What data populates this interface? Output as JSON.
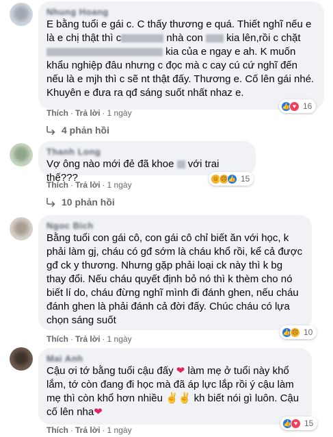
{
  "comments": [
    {
      "name": "Nhung Hoang",
      "text": "E bằng tuổi e gái c. C thấy thương e quá. Thiết nghĩ nếu e là e chị thật thì c",
      "text_b": " nhà con ",
      "text_c": " kia lên,rồi c chặt",
      "text_d": " kia của e ngay e ah. K muốn khẩu nghiệp đâu nhưng c đọc mà c cay cú cứ nghĩ đến nếu là e mjh thì c sẽ nt thật đấy. Thương e. Cố lên gái nhé. Khuyên e đưa ra qđ sáng suốt nhất nhaz e.",
      "like": "Thích",
      "reply": "Trả lời",
      "time": "1 ngày",
      "reaction_count": "16",
      "replies_label": "4 phản hồi"
    },
    {
      "name": "Thanh Long",
      "text": "Vợ ông nào mới đẻ đã khoe",
      "text_b": " với trai thế???",
      "like": "Thích",
      "reply": "Trả lời",
      "time": "1 ngày",
      "reaction_count": "15",
      "replies_label": "10 phản hồi"
    },
    {
      "name": "Ngoc Bich",
      "text": "Bằng tuổi con gái cô, con gái cô chỉ biết ăn với học, k phải làm gj, cháu có gđ sớm là cháu khổ rồi, kể cả được gđ ck y thương. Nhưng gặp phải loại ck này thì k bg thay đổi. Nếu cháu quyết định bỏ nó thì k thèm cho nó biết lí do, cháu đừng nghĩ mình đi đánh ghen, nếu cháu đánh ghen là phải đánh cả đời đấy. Chúc cháu có lựa chọn sáng suốt",
      "like": "Thích",
      "reply": "Trả lời",
      "time": "1 ngày",
      "reaction_count": "10"
    },
    {
      "name": "Mai Anh",
      "text_pre": "Cậu ơi tớ bằng tuổi cậu đấy ",
      "text": " làm mẹ ở tuổi này khổ lắm, tớ còn đang đi học mà đã áp lực lắp rồi ý cậu làm mẹ thì còn khổ hơn nhiều ",
      "text_b": " kh biết nói gì luôn. Cậu cố lên nha",
      "like": "Thích",
      "reply": "Trả lời",
      "time": "1 ngày",
      "reaction_count": "15"
    }
  ],
  "colors": {
    "like": "#1877f2",
    "love": "#f33e58",
    "haha": "#f7b125",
    "bubble": "#f0f2f5",
    "meta": "#65676b"
  }
}
